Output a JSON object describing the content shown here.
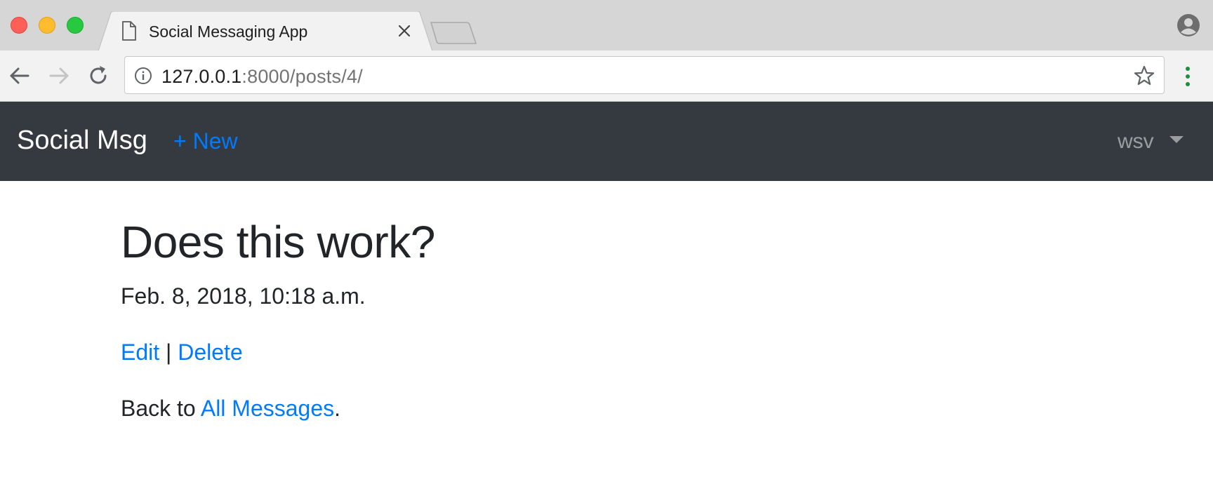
{
  "browser": {
    "tab_title": "Social Messaging App",
    "url_host": "127.0.0.1",
    "url_rest": ":8000/posts/4/"
  },
  "navbar": {
    "brand": "Social Msg",
    "new_link": "+ New",
    "user": "wsv"
  },
  "post": {
    "title": "Does this work?",
    "date": "Feb. 8, 2018, 10:18 a.m.",
    "edit_label": "Edit",
    "separator": "|",
    "delete_label": "Delete",
    "back_prefix": "Back to",
    "back_link": "All Messages",
    "back_suffix": "."
  },
  "colors": {
    "navbar_bg": "#343a40",
    "link": "#007bff",
    "text": "#212529"
  },
  "icons": {
    "traffic_lights": [
      "close-icon",
      "minimize-icon",
      "maximize-icon"
    ],
    "tab": "document-icon",
    "tab_close": "close-icon",
    "back": "arrow-left-icon",
    "forward": "arrow-right-icon",
    "reload": "reload-icon",
    "site_info": "info-icon",
    "bookmark": "star-icon",
    "menu": "kebab-menu-icon",
    "profile": "profile-icon"
  }
}
